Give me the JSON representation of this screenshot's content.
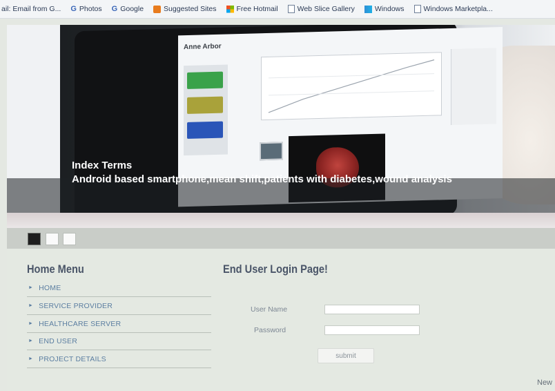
{
  "favorites_bar": {
    "items": [
      {
        "label": "ail: Email from G...",
        "icon": "mail-icon"
      },
      {
        "label": "Photos",
        "icon": "google-icon"
      },
      {
        "label": "Google",
        "icon": "google-icon"
      },
      {
        "label": "Suggested Sites",
        "icon": "suggested-sites-icon"
      },
      {
        "label": "Free Hotmail",
        "icon": "windows-icon"
      },
      {
        "label": "Web Slice Gallery",
        "icon": "page-icon"
      },
      {
        "label": "Windows",
        "icon": "msn-icon"
      },
      {
        "label": "Windows Marketpla...",
        "icon": "page-icon"
      }
    ]
  },
  "hero": {
    "app_title": "Anne Arbor",
    "caption_title": "Index Terms",
    "caption_text": "Android based smartphone,mean shift,patients with diabetes,wound analysis"
  },
  "slider": {
    "dots": [
      {
        "state": "active"
      },
      {
        "state": "inactive"
      },
      {
        "state": "inactive"
      }
    ]
  },
  "menu": {
    "heading": "Home Menu",
    "items": [
      {
        "label": "HOME"
      },
      {
        "label": "SERVICE PROVIDER"
      },
      {
        "label": "HEALTHCARE SERVER"
      },
      {
        "label": "END USER"
      },
      {
        "label": "PROJECT DETAILS"
      }
    ]
  },
  "login": {
    "heading": "End User Login Page!",
    "username_label": "User Name",
    "username_value": "",
    "password_label": "Password",
    "password_value": "",
    "submit_label": "submit"
  },
  "corner_text": "New",
  "colors": {
    "page_bg": "#e4e9e2",
    "heading": "#4a5568",
    "menu_link": "#5b7ea1",
    "caption_text": "#ffffff"
  }
}
